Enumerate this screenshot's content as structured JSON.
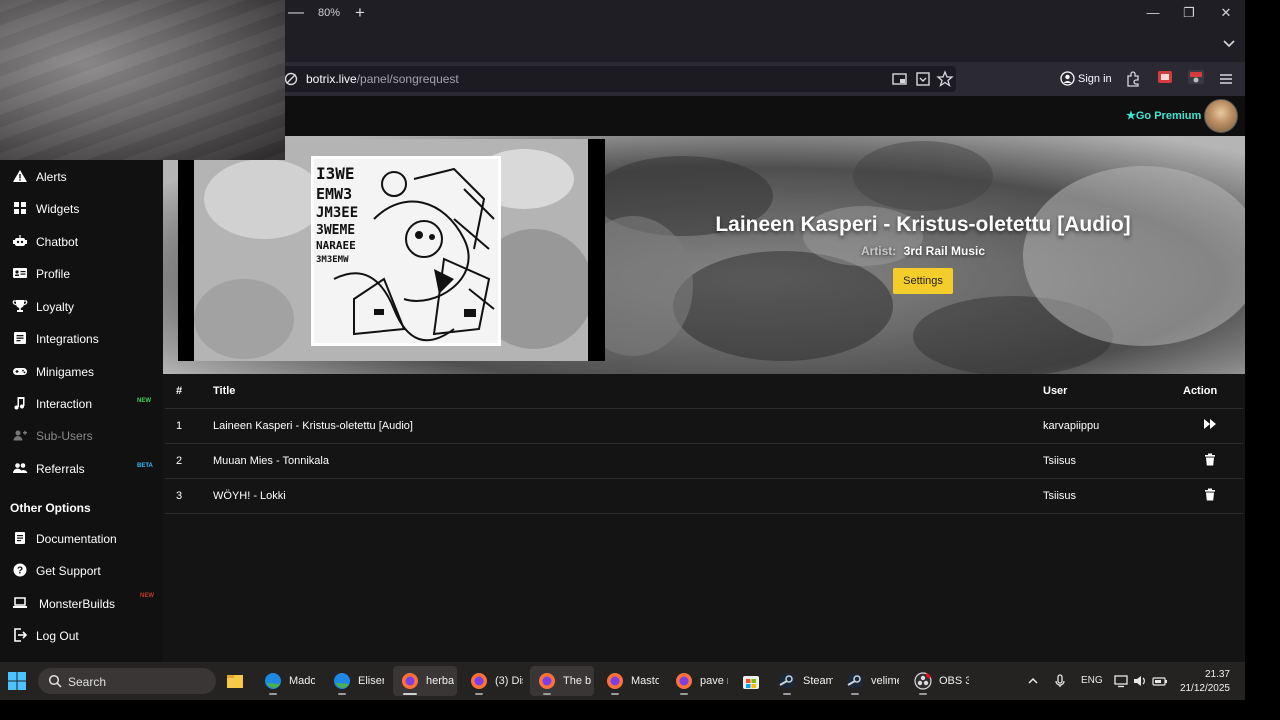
{
  "browser": {
    "zoom_minus": "—",
    "zoom_level": "80%",
    "zoom_plus": "+",
    "url_host": "botrix.live",
    "url_path": "/panel/songrequest",
    "sign_in": "Sign in",
    "window_minimize": "—",
    "window_restore": "❐",
    "window_close": "✕"
  },
  "header": {
    "go_premium": "Go Premium"
  },
  "sidebar": {
    "items": [
      {
        "label": "Alerts",
        "icon": "warning-icon"
      },
      {
        "label": "Widgets",
        "icon": "grid-icon"
      },
      {
        "label": "Chatbot",
        "icon": "robot-icon"
      },
      {
        "label": "Profile",
        "icon": "id-card-icon"
      },
      {
        "label": "Loyalty",
        "icon": "trophy-icon"
      },
      {
        "label": "Integrations",
        "icon": "integrations-icon"
      },
      {
        "label": "Minigames",
        "icon": "gamepad-icon"
      },
      {
        "label": "Interaction",
        "icon": "music-note-icon",
        "badge": "NEW"
      },
      {
        "label": "Sub-Users",
        "icon": "sub-users-icon"
      },
      {
        "label": "Referrals",
        "icon": "users-icon",
        "badge": "BETA"
      }
    ],
    "other_options_heading": "Other Options",
    "other_items": [
      {
        "label": "Documentation",
        "icon": "scroll-icon"
      },
      {
        "label": "Get Support",
        "icon": "question-icon"
      },
      {
        "label": "MonsterBuilds",
        "icon": "laptop-icon",
        "badge": "NEW"
      },
      {
        "label": "Log Out",
        "icon": "logout-icon"
      }
    ],
    "badge_colors": {
      "NEW": "#39d353",
      "BETA": "#2fb8ff",
      "MonsterBuilds": "#c0392b"
    }
  },
  "player": {
    "title": "Laineen Kasperi - Kristus-oletettu [Audio]",
    "artist_label": "Artist:",
    "artist_name": "3rd Rail Music",
    "settings_label": "Settings",
    "accent": "#f4cd2a"
  },
  "queue": {
    "headers": {
      "num": "#",
      "title": "Title",
      "user": "User",
      "action": "Action"
    },
    "rows": [
      {
        "num": "1",
        "title": "Laineen Kasperi - Kristus-oletettu [Audio]",
        "user": "karvapiippu",
        "action_icon": "skip-forward-icon"
      },
      {
        "num": "2",
        "title": "Muuan Mies - Tonnikala",
        "user": "Tsiisus",
        "action_icon": "trash-icon"
      },
      {
        "num": "3",
        "title": "WÖYH! - Lokki",
        "user": "Tsiisus",
        "action_icon": "trash-icon"
      }
    ]
  },
  "taskbar": {
    "search": "Search",
    "apps": [
      {
        "label": "",
        "icon": "file-explorer-icon"
      },
      {
        "label": "Madoı",
        "icon": "edge-icon"
      },
      {
        "label": "Elisen",
        "icon": "edge-icon"
      },
      {
        "label": "herbal",
        "icon": "firefox-icon"
      },
      {
        "label": "(3) Dis",
        "icon": "firefox-icon"
      },
      {
        "label": "The be",
        "icon": "firefox-icon"
      },
      {
        "label": "Masto",
        "icon": "firefox-icon"
      },
      {
        "label": "pave r",
        "icon": "firefox-icon"
      },
      {
        "label": "",
        "icon": "store-icon"
      },
      {
        "label": "Steam",
        "icon": "steam-icon"
      },
      {
        "label": "velime",
        "icon": "steam-icon"
      },
      {
        "label": "OBS 3",
        "icon": "obs-icon"
      }
    ],
    "lang": "ENG",
    "time": "21.37",
    "date": "21/12/2025"
  }
}
